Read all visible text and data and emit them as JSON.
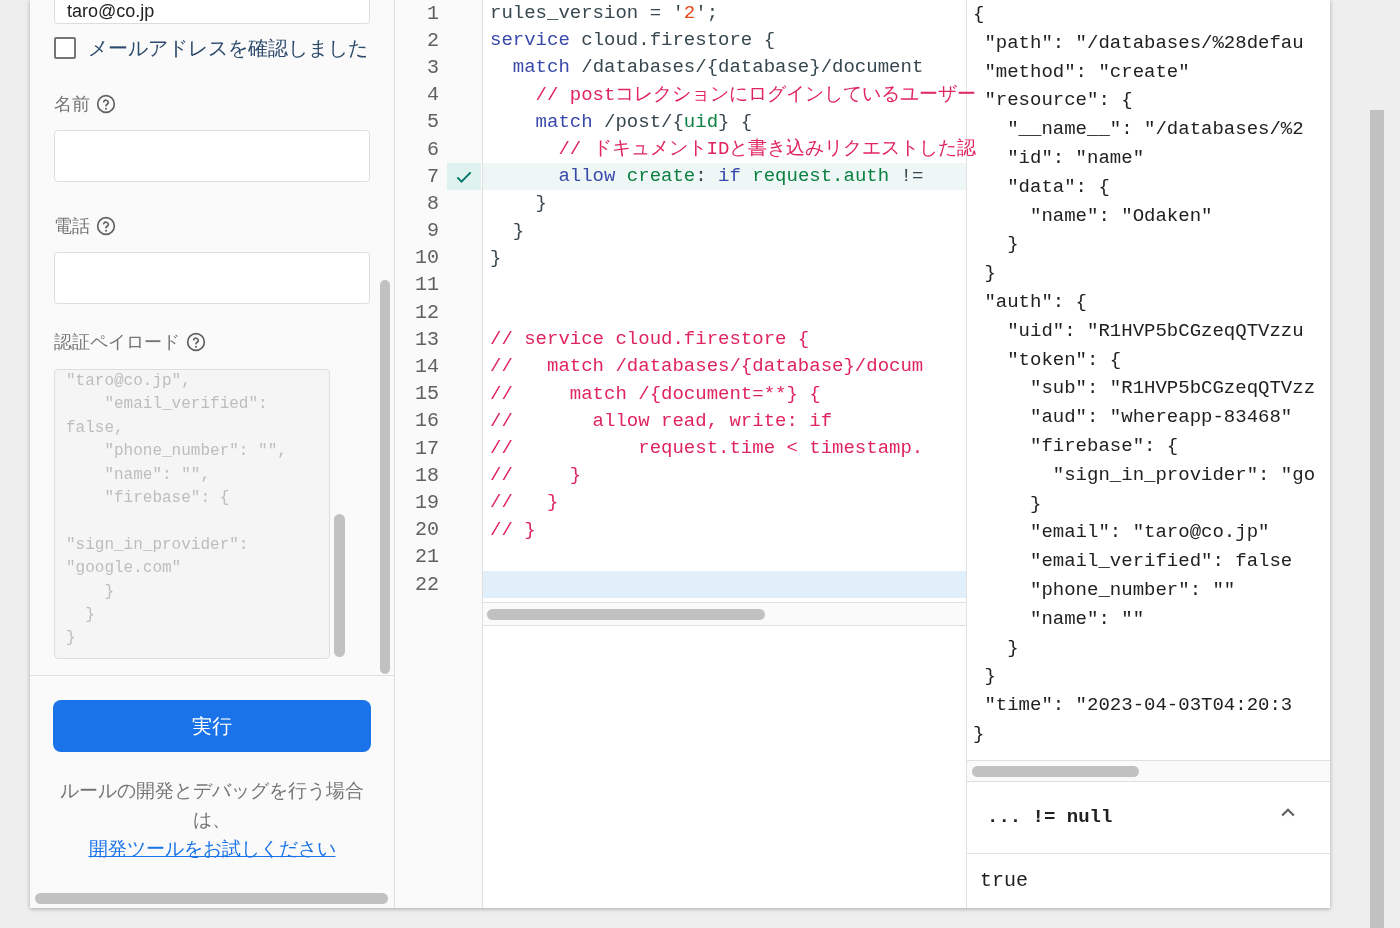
{
  "form": {
    "email_field": {
      "value": "taro@co.jp"
    },
    "email_verified": {
      "label": "メールアドレスを確認しました",
      "checked": false
    },
    "fields": [
      {
        "label": "名前"
      },
      {
        "label": "電話"
      }
    ],
    "payload": {
      "label": "認証ペイロード",
      "text": "\"taro@co.jp\",\n    \"email_verified\":\nfalse,\n    \"phone_number\": \"\",\n    \"name\": \"\",\n    \"firebase\": {\n\n\"sign_in_provider\":\n\"google.com\"\n    }\n  }\n}",
      "disabled": true
    },
    "run_button": "実行",
    "hint": "ルールの開発とデバッグを行う場合は、",
    "hint_link": "開発ツールをお試しください"
  },
  "editor": {
    "lines": [
      {
        "number": "1",
        "passed": false,
        "cursor": false,
        "tokens": [
          {
            "kind": "plain",
            "text": "rules_version = '"
          },
          {
            "kind": "string",
            "text": "2"
          },
          {
            "kind": "plain",
            "text": "';"
          }
        ]
      },
      {
        "number": "2",
        "passed": false,
        "cursor": false,
        "tokens": [
          {
            "kind": "keyword",
            "text": "service"
          },
          {
            "kind": "plain",
            "text": " cloud.firestore {"
          }
        ]
      },
      {
        "number": "3",
        "passed": false,
        "cursor": false,
        "tokens": [
          {
            "kind": "keyword",
            "text": "  match"
          },
          {
            "kind": "plain",
            "text": " /databases/{database}/document"
          }
        ]
      },
      {
        "number": "4",
        "passed": false,
        "cursor": false,
        "tokens": [
          {
            "kind": "comment",
            "text": "    // postコレクションにログインしているユーザー"
          }
        ]
      },
      {
        "number": "5",
        "passed": false,
        "cursor": false,
        "tokens": [
          {
            "kind": "keyword",
            "text": "    match"
          },
          {
            "kind": "plain",
            "text": " /post/{"
          },
          {
            "kind": "ident",
            "text": "uid"
          },
          {
            "kind": "plain",
            "text": "} {"
          }
        ]
      },
      {
        "number": "6",
        "passed": false,
        "cursor": false,
        "tokens": [
          {
            "kind": "comment",
            "text": "      // ドキュメントIDと書き込みリクエストした認"
          }
        ]
      },
      {
        "number": "7",
        "passed": true,
        "cursor": false,
        "tokens": [
          {
            "kind": "keyword",
            "text": "      allow"
          },
          {
            "kind": "ident",
            "text": " create"
          },
          {
            "kind": "plain",
            "text": ": "
          },
          {
            "kind": "keyword",
            "text": "if"
          },
          {
            "kind": "ident",
            "text": " request.auth"
          },
          {
            "kind": "plain",
            "text": " !="
          }
        ]
      },
      {
        "number": "8",
        "passed": false,
        "cursor": false,
        "tokens": [
          {
            "kind": "plain",
            "text": "    }"
          }
        ]
      },
      {
        "number": "9",
        "passed": false,
        "cursor": false,
        "tokens": [
          {
            "kind": "plain",
            "text": "  }"
          }
        ]
      },
      {
        "number": "10",
        "passed": false,
        "cursor": false,
        "tokens": [
          {
            "kind": "plain",
            "text": "}"
          }
        ]
      },
      {
        "number": "11",
        "passed": false,
        "cursor": false
      },
      {
        "number": "12",
        "passed": false,
        "cursor": false
      },
      {
        "number": "13",
        "passed": false,
        "cursor": false,
        "tokens": [
          {
            "kind": "comment",
            "text": "// service cloud.firestore {"
          }
        ]
      },
      {
        "number": "14",
        "passed": false,
        "cursor": false,
        "tokens": [
          {
            "kind": "comment",
            "text": "//   match /databases/{database}/docum"
          }
        ]
      },
      {
        "number": "15",
        "passed": false,
        "cursor": false,
        "tokens": [
          {
            "kind": "comment",
            "text": "//     match /{document=**} {"
          }
        ]
      },
      {
        "number": "16",
        "passed": false,
        "cursor": false,
        "tokens": [
          {
            "kind": "comment",
            "text": "//       allow read, write: if"
          }
        ]
      },
      {
        "number": "17",
        "passed": false,
        "cursor": false,
        "tokens": [
          {
            "kind": "comment",
            "text": "//           request.time < timestamp."
          }
        ]
      },
      {
        "number": "18",
        "passed": false,
        "cursor": false,
        "tokens": [
          {
            "kind": "comment",
            "text": "//     }"
          }
        ]
      },
      {
        "number": "19",
        "passed": false,
        "cursor": false,
        "tokens": [
          {
            "kind": "comment",
            "text": "//   }"
          }
        ]
      },
      {
        "number": "20",
        "passed": false,
        "cursor": false,
        "tokens": [
          {
            "kind": "comment",
            "text": "// }"
          }
        ]
      },
      {
        "number": "21",
        "passed": false,
        "cursor": false
      },
      {
        "number": "22",
        "passed": false,
        "cursor": true
      }
    ]
  },
  "request_json": [
    "{",
    " \"path\": \"/databases/%28defau",
    " \"method\": \"create\"",
    " \"resource\": {",
    "   \"__name__\": \"/databases/%2",
    "   \"id\": \"name\"",
    "   \"data\": {",
    "     \"name\": \"Odaken\"",
    "   }",
    " }",
    " \"auth\": {",
    "   \"uid\": \"R1HVP5bCGzeqQTVzzu",
    "   \"token\": {",
    "     \"sub\": \"R1HVP5bCGzeqQTVzz",
    "     \"aud\": \"whereapp-83468\"",
    "     \"firebase\": {",
    "       \"sign_in_provider\": \"go",
    "     }",
    "     \"email\": \"taro@co.jp\"",
    "     \"email_verified\": false",
    "     \"phone_number\": \"\"",
    "     \"name\": \"\"",
    "   }",
    " }",
    " \"time\": \"2023-04-03T04:20:3",
    "}"
  ],
  "evaluation": {
    "expression": "... != null",
    "expanded": true,
    "result": "true"
  }
}
